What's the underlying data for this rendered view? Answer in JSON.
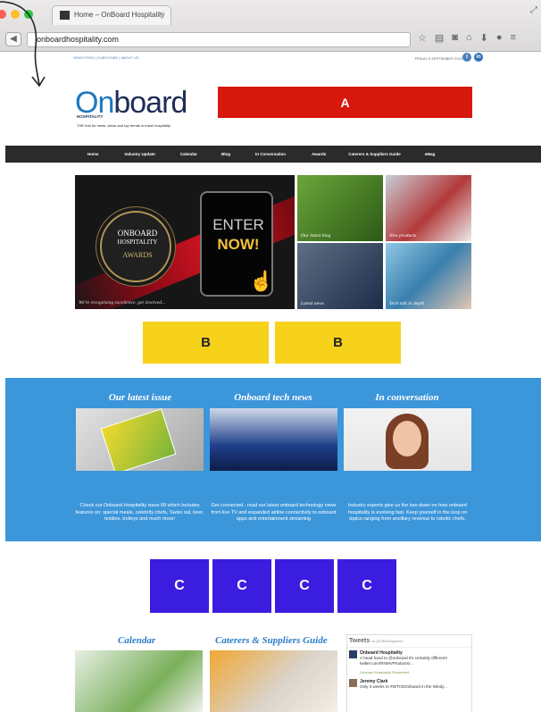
{
  "browser": {
    "tab_title": "Home – OnBoard Hospitality",
    "tab_close": "✕",
    "url": "onboardhospitality.com",
    "back": "◀"
  },
  "site": {
    "top_links": "NEWS FEED | SUBSCRIBE | ABOUT US",
    "date": "FRIDAY 5 SEPTEMBER 2014",
    "logo_on": "On",
    "logo_rest": "board",
    "logo_sub": "HOSPITALITY",
    "tagline": "THE hub for news, views and top trends in travel hospitality",
    "nav": [
      "Home",
      "Industry Update",
      "Calendar",
      "Blog",
      "In Conversation",
      "Awards",
      "Caterers & Suppliers Guide",
      "eMag"
    ]
  },
  "placeholders": {
    "a": "A",
    "b": "B",
    "c": "C"
  },
  "hero": {
    "award_line1": "ONBOARD",
    "award_line2": "HOSPITALITY",
    "award_line3": "AWARDS",
    "enter": "ENTER",
    "now": "NOW!",
    "caption": "We're recognising excellence, get involved..."
  },
  "tiles": [
    {
      "caption": "Our latest blog",
      "color": "#3a7a22"
    },
    {
      "caption": "New products",
      "color": "#b23a3a"
    },
    {
      "caption": "Latest news",
      "color": "#253a5e"
    },
    {
      "caption": "Tech talk in depth",
      "color": "#4f8fb0"
    }
  ],
  "features": [
    {
      "title": "Our latest issue",
      "text": "Check out Onboard Hospitality issue 68 which includes features on: special meals, celebrity chefs, Swiss rail, beer, textiles, trolleys and much more!"
    },
    {
      "title": "Onboard tech news",
      "text": "Get connected - read our latest onboard technology news from live TV and expanded airline connectivity to onboard apps and entertainment streaming"
    },
    {
      "title": "In conversation",
      "text": "Industry experts give us the low-down on how onboard hospitality is evolving fast. Keep yourself in the loop on topics ranging from ancillary revenue to robotic chefs."
    }
  ],
  "bottom": {
    "calendar_title": "Calendar",
    "guide_title": "Caterers & Suppliers Guide",
    "tweets_title": "Tweets",
    "tweets_handle": "by @OBHMagazine",
    "tweet1_author": "Onboard Hospitality",
    "tweet1_text": "A head hand to @onboard it's certainly different! twitter.com/RNMVProducts/...",
    "retweet_note": "Onboard Hospitality Retweeted",
    "tweet2_author": "Jeremy Clark",
    "tweet2_text": "Only 3 weeks to #WTCEOnboard in the Windy..."
  },
  "colors": {
    "placeholder_a": "#d7180d",
    "placeholder_b": "#f7d21b",
    "placeholder_c": "#3b1de0",
    "blue_band": "#3c96da",
    "nav_bar": "#2b2b2b"
  }
}
